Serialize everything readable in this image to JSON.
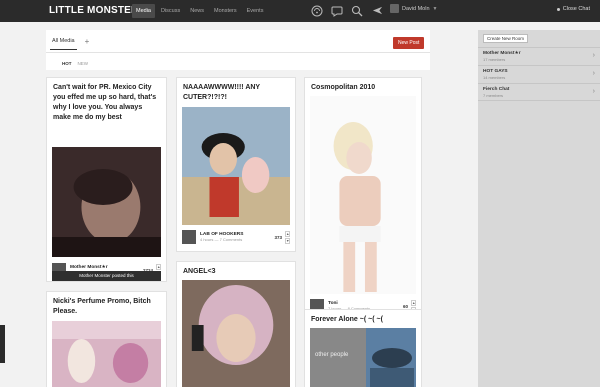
{
  "header": {
    "brand": "LITTLE MONSTERS",
    "nav": [
      "Media",
      "Discuss",
      "News",
      "Monsters",
      "Events"
    ],
    "active_nav": "Media",
    "icons": [
      "wifi-icon",
      "speech-bubble-icon",
      "search-icon",
      "plane-icon"
    ],
    "user": "David Moln",
    "close_chat": "Close Chat"
  },
  "tabs": {
    "all_media": "All Media",
    "add": "+",
    "new_post": "New Post"
  },
  "sort": {
    "hot": "HOT",
    "new": "NEW"
  },
  "cards": [
    {
      "title": "Can't wait for PR. Mexico City you effed me up so hard, that's why I love you. You always make me do my best",
      "author": "Mother Monst★r",
      "sub": "3 hours — 486 Comments",
      "score": "2724",
      "posted_by": "Mother Monster posted this"
    },
    {
      "title": "Nicki's Perfume Promo, Bitch Please."
    },
    {
      "title": "NAAAAWWWW!!!! ANY CUTER?!?!?!",
      "author": "LAB OF HOOKERS",
      "sub": "4 hours — 7 Comments",
      "score": "373"
    },
    {
      "title": "ANGEL<3"
    },
    {
      "title": "Cosmopolitan 2010",
      "author": "Toni",
      "sub": "7 hours — 8 Comments",
      "score": "60"
    },
    {
      "title": "Forever Alone ~( ~( ~(",
      "image_caption": "other people"
    }
  ],
  "sidebar": {
    "create_room": "Create New Room",
    "rooms": [
      {
        "name": "Mother Monst★r",
        "sub": "17 members"
      },
      {
        "name": "HOT GAYS",
        "sub": "14 members"
      },
      {
        "name": "Fierch Chat",
        "sub": "7 members"
      }
    ]
  },
  "colors": {
    "topbar": "#2b2b2b",
    "accent": "#c0392b",
    "sidebar": "#d8d8d8"
  }
}
